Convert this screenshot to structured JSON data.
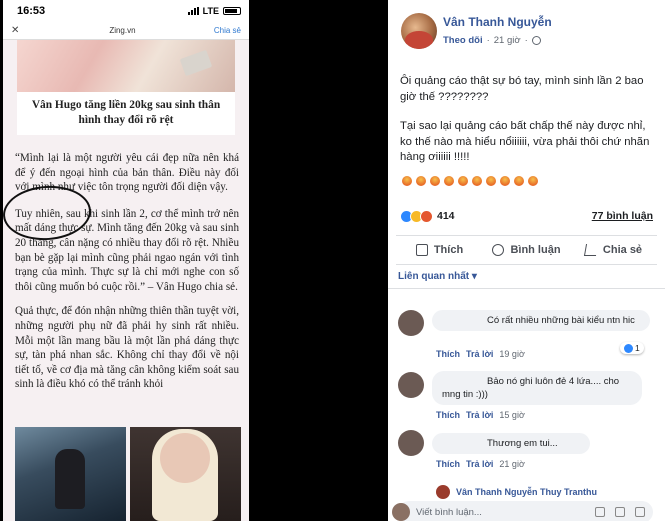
{
  "phone": {
    "status": {
      "time": "16:53",
      "network": "LTE"
    },
    "url_bar": {
      "close": "✕",
      "host": "Zing.vn",
      "share": "Chia sẻ"
    },
    "caption": "Vân Hugo tăng liền 20kg sau sinh thân hình thay đổi rõ rệt",
    "paragraphs": [
      "“Mình lại là một người yêu cái đẹp nữa nên khá để ý đến ngoại hình của bản thân. Điều này đối với mình như việc tôn trọng người đối diện vậy.",
      "Tuy nhiên, sau khi sinh lần 2, cơ thể mình trở nên mất dáng thực sự. Mình tăng đến 20kg và sau sinh 20 tháng, cân nặng có nhiều thay đổi rõ rệt. Nhiều bạn bè gặp lại mình cũng phải ngao ngán với tình trạng của mình. Thực sự là chỉ mới nghe con số thôi cũng muốn bỏ cuộc rồi.” – Vân Hugo chia sẻ.",
      "Quả thực, để đón nhận những thiên thần tuyệt vời, những người phụ nữ đã phải hy sinh rất nhiều. Mỗi một lần mang bầu là một lần phá dáng thực sự, tàn phá nhan sắc. Không chỉ thay đổi về nội tiết tố, về cơ địa mà tăng cân không kiểm soát sau sinh là điều khó có thể tránh khỏi"
    ]
  },
  "fb": {
    "author": "Vân Thanh Nguyễn",
    "follow": "Theo dõi",
    "time": "21 giờ",
    "post_line1": "Ôi quảng cáo thật sự bó tay, mình sinh lần 2 bao giờ thế ????????",
    "post_line2": "Tại sao lại quảng cáo bất chấp thế này được nhỉ, ko thế nào mà hiểu nổiiiiii, vừa phải thôi chứ nhãn hàng ơiiiiii !!!!!",
    "reaction_count": "414",
    "comment_count": "77 bình luận",
    "actions": {
      "like": "Thích",
      "comment": "Bình luận",
      "share": "Chia sẻ"
    },
    "related": "Liên quan nhất",
    "comments": [
      {
        "text": "Có rất nhiều những bài kiểu ntn hic",
        "like": "Thích",
        "reply": "Trả lời",
        "time": "19 giờ",
        "badge": "1"
      },
      {
        "text": "Bảo nó ghi luôn đẻ 4 lứa.... cho mng tin :)))",
        "like": "Thích",
        "reply": "Trả lời",
        "time": "15 giờ"
      },
      {
        "text": "Thương em tui...",
        "like": "Thích",
        "reply": "Trả lời",
        "time": "21 giờ"
      }
    ],
    "reply_names": "Vân Thanh Nguyễn Thuy Tranthu",
    "write_placeholder": "Viết bình luận..."
  }
}
